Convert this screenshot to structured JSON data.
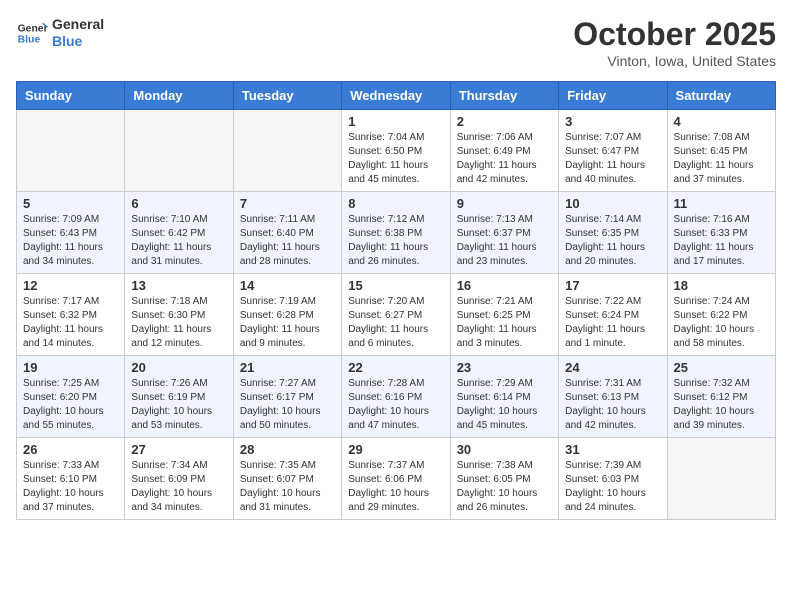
{
  "header": {
    "logo_line1": "General",
    "logo_line2": "Blue",
    "month": "October 2025",
    "location": "Vinton, Iowa, United States"
  },
  "weekdays": [
    "Sunday",
    "Monday",
    "Tuesday",
    "Wednesday",
    "Thursday",
    "Friday",
    "Saturday"
  ],
  "weeks": [
    [
      {
        "day": "",
        "info": ""
      },
      {
        "day": "",
        "info": ""
      },
      {
        "day": "",
        "info": ""
      },
      {
        "day": "1",
        "info": "Sunrise: 7:04 AM\nSunset: 6:50 PM\nDaylight: 11 hours and 45 minutes."
      },
      {
        "day": "2",
        "info": "Sunrise: 7:06 AM\nSunset: 6:49 PM\nDaylight: 11 hours and 42 minutes."
      },
      {
        "day": "3",
        "info": "Sunrise: 7:07 AM\nSunset: 6:47 PM\nDaylight: 11 hours and 40 minutes."
      },
      {
        "day": "4",
        "info": "Sunrise: 7:08 AM\nSunset: 6:45 PM\nDaylight: 11 hours and 37 minutes."
      }
    ],
    [
      {
        "day": "5",
        "info": "Sunrise: 7:09 AM\nSunset: 6:43 PM\nDaylight: 11 hours and 34 minutes."
      },
      {
        "day": "6",
        "info": "Sunrise: 7:10 AM\nSunset: 6:42 PM\nDaylight: 11 hours and 31 minutes."
      },
      {
        "day": "7",
        "info": "Sunrise: 7:11 AM\nSunset: 6:40 PM\nDaylight: 11 hours and 28 minutes."
      },
      {
        "day": "8",
        "info": "Sunrise: 7:12 AM\nSunset: 6:38 PM\nDaylight: 11 hours and 26 minutes."
      },
      {
        "day": "9",
        "info": "Sunrise: 7:13 AM\nSunset: 6:37 PM\nDaylight: 11 hours and 23 minutes."
      },
      {
        "day": "10",
        "info": "Sunrise: 7:14 AM\nSunset: 6:35 PM\nDaylight: 11 hours and 20 minutes."
      },
      {
        "day": "11",
        "info": "Sunrise: 7:16 AM\nSunset: 6:33 PM\nDaylight: 11 hours and 17 minutes."
      }
    ],
    [
      {
        "day": "12",
        "info": "Sunrise: 7:17 AM\nSunset: 6:32 PM\nDaylight: 11 hours and 14 minutes."
      },
      {
        "day": "13",
        "info": "Sunrise: 7:18 AM\nSunset: 6:30 PM\nDaylight: 11 hours and 12 minutes."
      },
      {
        "day": "14",
        "info": "Sunrise: 7:19 AM\nSunset: 6:28 PM\nDaylight: 11 hours and 9 minutes."
      },
      {
        "day": "15",
        "info": "Sunrise: 7:20 AM\nSunset: 6:27 PM\nDaylight: 11 hours and 6 minutes."
      },
      {
        "day": "16",
        "info": "Sunrise: 7:21 AM\nSunset: 6:25 PM\nDaylight: 11 hours and 3 minutes."
      },
      {
        "day": "17",
        "info": "Sunrise: 7:22 AM\nSunset: 6:24 PM\nDaylight: 11 hours and 1 minute."
      },
      {
        "day": "18",
        "info": "Sunrise: 7:24 AM\nSunset: 6:22 PM\nDaylight: 10 hours and 58 minutes."
      }
    ],
    [
      {
        "day": "19",
        "info": "Sunrise: 7:25 AM\nSunset: 6:20 PM\nDaylight: 10 hours and 55 minutes."
      },
      {
        "day": "20",
        "info": "Sunrise: 7:26 AM\nSunset: 6:19 PM\nDaylight: 10 hours and 53 minutes."
      },
      {
        "day": "21",
        "info": "Sunrise: 7:27 AM\nSunset: 6:17 PM\nDaylight: 10 hours and 50 minutes."
      },
      {
        "day": "22",
        "info": "Sunrise: 7:28 AM\nSunset: 6:16 PM\nDaylight: 10 hours and 47 minutes."
      },
      {
        "day": "23",
        "info": "Sunrise: 7:29 AM\nSunset: 6:14 PM\nDaylight: 10 hours and 45 minutes."
      },
      {
        "day": "24",
        "info": "Sunrise: 7:31 AM\nSunset: 6:13 PM\nDaylight: 10 hours and 42 minutes."
      },
      {
        "day": "25",
        "info": "Sunrise: 7:32 AM\nSunset: 6:12 PM\nDaylight: 10 hours and 39 minutes."
      }
    ],
    [
      {
        "day": "26",
        "info": "Sunrise: 7:33 AM\nSunset: 6:10 PM\nDaylight: 10 hours and 37 minutes."
      },
      {
        "day": "27",
        "info": "Sunrise: 7:34 AM\nSunset: 6:09 PM\nDaylight: 10 hours and 34 minutes."
      },
      {
        "day": "28",
        "info": "Sunrise: 7:35 AM\nSunset: 6:07 PM\nDaylight: 10 hours and 31 minutes."
      },
      {
        "day": "29",
        "info": "Sunrise: 7:37 AM\nSunset: 6:06 PM\nDaylight: 10 hours and 29 minutes."
      },
      {
        "day": "30",
        "info": "Sunrise: 7:38 AM\nSunset: 6:05 PM\nDaylight: 10 hours and 26 minutes."
      },
      {
        "day": "31",
        "info": "Sunrise: 7:39 AM\nSunset: 6:03 PM\nDaylight: 10 hours and 24 minutes."
      },
      {
        "day": "",
        "info": ""
      }
    ]
  ]
}
